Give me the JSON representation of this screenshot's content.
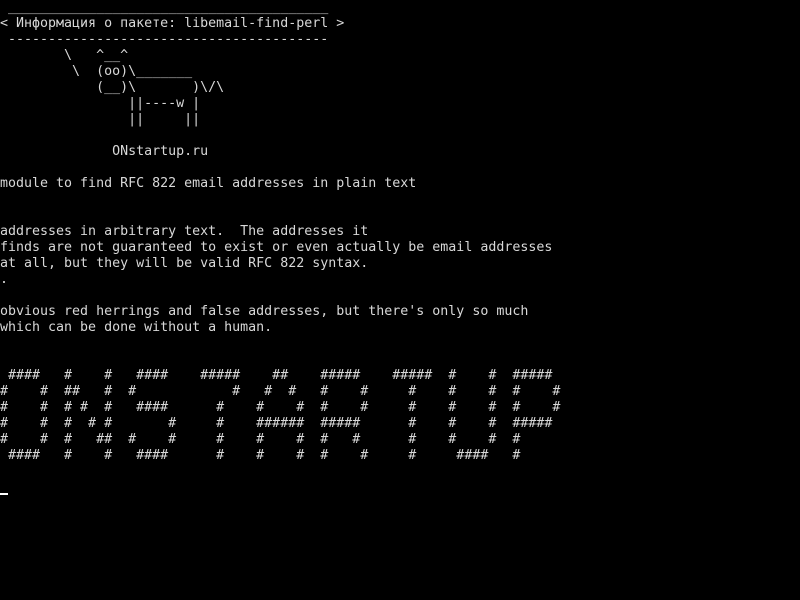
{
  "terminal": {
    "lines": [
      " ________________________________________",
      "< Информация о пакете: libemail-find-perl >",
      " ----------------------------------------",
      "        \\   ^__^",
      "         \\  (oo)\\_______",
      "            (__)\\       )\\/\\",
      "                ||----w |",
      "                ||     ||",
      "",
      "              ONstartup.ru",
      "",
      "module to find RFC 822 email addresses in plain text",
      "",
      "",
      "addresses in arbitrary text.  The addresses it",
      "finds are not guaranteed to exist or even actually be email addresses",
      "at all, but they will be valid RFC 822 syntax.",
      ".",
      "",
      "obvious red herrings and false addresses, but there's only so much",
      "which can be done without a human.",
      "",
      "",
      " ####   #    #   ####    #####    ##    #####    #####  #    #  #####",
      "#    #  ##   #  #            #   #  #   #    #     #    #    #  #    #",
      "#    #  # #  #   ####      #    #    #  #    #     #    #    #  #    #",
      "#    #  #  # #       #     #    ######  #####      #    #    #  #####",
      "#    #  #   ##  #    #     #    #    #  #   #      #    #    #  #",
      " ####   #    #   ####      #    #    #  #    #     #     ####   #"
    ]
  },
  "colors": {
    "background": "#000000",
    "foreground": "#d8d8d8",
    "cursor": "#ffffff"
  }
}
